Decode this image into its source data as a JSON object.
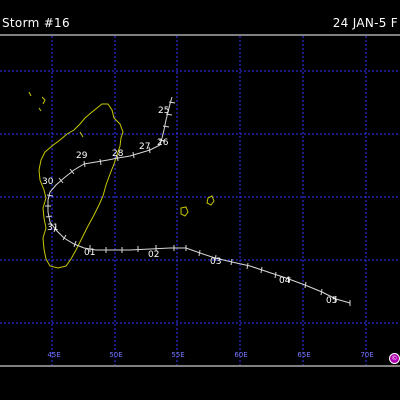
{
  "header": {
    "title": "Storm #16",
    "date_range": "24 JAN-5 F"
  },
  "logo": {
    "name": "copyright-logo",
    "glyph": "©",
    "color": "#b000b0"
  },
  "colors": {
    "background": "#000000",
    "grid": "#3333ff",
    "land": "#c8c800",
    "track": "#d8d8d8",
    "text": "#ffffff",
    "axis_label": "#7777ff"
  },
  "longitude_labels": [
    "45E",
    "50E",
    "55E",
    "60E",
    "65E",
    "70E"
  ],
  "track_day_labels": [
    "25",
    "26",
    "27",
    "28",
    "29",
    "30",
    "31",
    "01",
    "02",
    "03",
    "04",
    "05"
  ]
}
